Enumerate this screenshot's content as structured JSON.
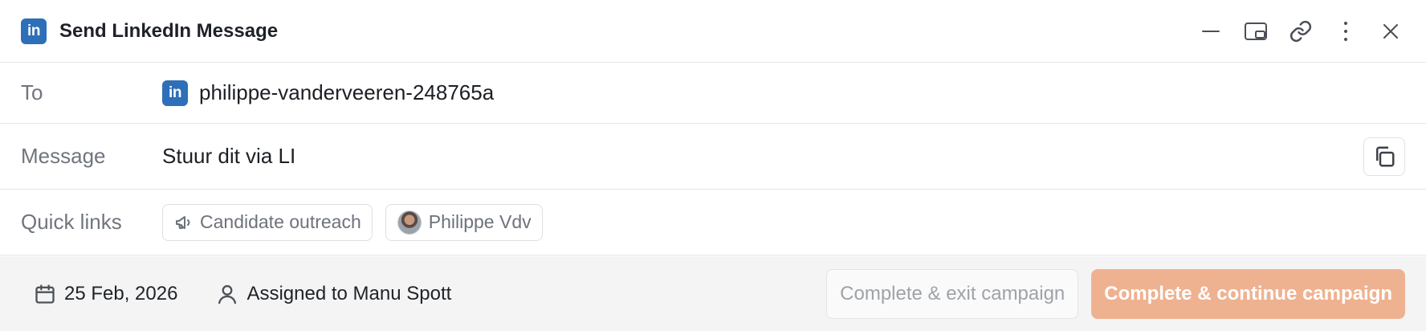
{
  "header": {
    "badge": "in",
    "title": "Send LinkedIn Message",
    "actions": [
      "minimize-icon",
      "picture-in-picture-icon",
      "link-icon",
      "more-vertical-icon",
      "close-icon"
    ]
  },
  "to": {
    "label": "To",
    "badge": "in",
    "value": "philippe-vanderveeren-248765a"
  },
  "message": {
    "label": "Message",
    "value": "Stuur dit via LI",
    "copy_icon": "copy-icon"
  },
  "quick_links": {
    "label": "Quick links",
    "items": [
      {
        "label": "Candidate outreach",
        "icon": "megaphone-icon"
      },
      {
        "label": "Philippe Vdv",
        "icon": "avatar"
      }
    ]
  },
  "footer": {
    "date": "25 Feb, 2026",
    "assigned": "Assigned to Manu Spott",
    "secondary_button": "Complete & exit campaign",
    "primary_button": "Complete & continue campaign"
  },
  "colors": {
    "linkedin": "#2d6fb8",
    "primary_button": "#efb291",
    "footer_bg": "#f4f4f5"
  }
}
